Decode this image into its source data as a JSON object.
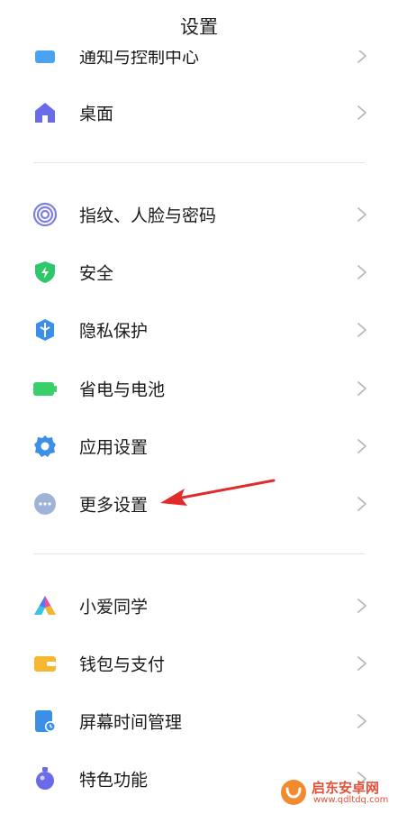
{
  "header": {
    "title": "设置"
  },
  "items": [
    {
      "label": "通知与控制中心",
      "icon": "notification-icon"
    },
    {
      "label": "桌面",
      "icon": "home-icon"
    },
    {
      "label": "指纹、人脸与密码",
      "icon": "fingerprint-icon"
    },
    {
      "label": "安全",
      "icon": "shield-icon"
    },
    {
      "label": "隐私保护",
      "icon": "privacy-icon"
    },
    {
      "label": "省电与电池",
      "icon": "battery-icon"
    },
    {
      "label": "应用设置",
      "icon": "gear-icon"
    },
    {
      "label": "更多设置",
      "icon": "more-icon"
    },
    {
      "label": "小爱同学",
      "icon": "xiaoai-icon"
    },
    {
      "label": "钱包与支付",
      "icon": "wallet-icon"
    },
    {
      "label": "屏幕时间管理",
      "icon": "screen-time-icon"
    },
    {
      "label": "特色功能",
      "icon": "special-features-icon"
    }
  ],
  "watermark": {
    "name": "启东安卓网",
    "url": "www.qdltdq.com"
  },
  "colors": {
    "blue": "#4aa3f0",
    "purple": "#6a6be8",
    "green": "#2ec86b",
    "battery_green": "#39d06a",
    "gray_blue": "#9fb2d8",
    "yellow": "#f5b731",
    "arrow_red": "#e22a2a"
  }
}
